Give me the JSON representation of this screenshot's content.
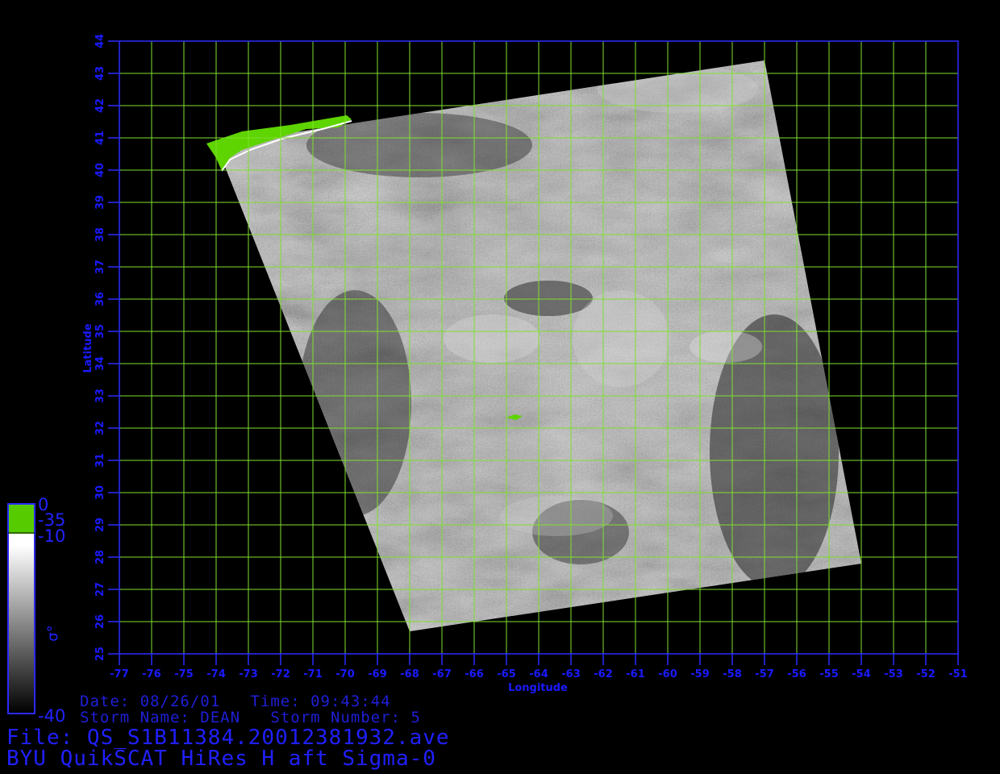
{
  "map": {
    "x_axis_label": "Longitude",
    "y_axis_label": "Latitude",
    "x_ticks": [
      "-77",
      "-76",
      "-75",
      "-74",
      "-73",
      "-72",
      "-71",
      "-70",
      "-69",
      "-68",
      "-67",
      "-66",
      "-65",
      "-64",
      "-63",
      "-62",
      "-61",
      "-60",
      "-59",
      "-58",
      "-57",
      "-56",
      "-55",
      "-54",
      "-53",
      "-52",
      "-51"
    ],
    "y_ticks": [
      "25",
      "26",
      "27",
      "28",
      "29",
      "30",
      "31",
      "32",
      "33",
      "34",
      "35",
      "36",
      "37",
      "38",
      "39",
      "40",
      "41",
      "42",
      "43",
      "44"
    ],
    "x_range": [
      -77,
      -51
    ],
    "y_range": [
      25,
      44
    ],
    "grid_color": "#7fe030",
    "axis_color": "#2a2aff",
    "swath_corners_lonlat": [
      [
        -74.0,
        40.8
      ],
      [
        -57.0,
        43.4
      ],
      [
        -54.0,
        27.8
      ],
      [
        -68.0,
        25.7
      ]
    ],
    "land_color": "#5ed400"
  },
  "colorbar": {
    "label_0": "0",
    "label_35": "-35",
    "label_10": "-10",
    "label_40": "-40",
    "symbol": "σ°",
    "colors": {
      "top": "#56cc00",
      "white": "#ffffff",
      "bottom": "#000000"
    }
  },
  "info": {
    "date_line": "Date: 08/26/01   Time: 09:43:44",
    "storm_line": "Storm Name: DEAN   Storm Number: 5",
    "file_line": "File: QS_S1B11384.20012381932.ave",
    "title_line": "BYU QuikSCAT HiRes H aft Sigma-0"
  }
}
